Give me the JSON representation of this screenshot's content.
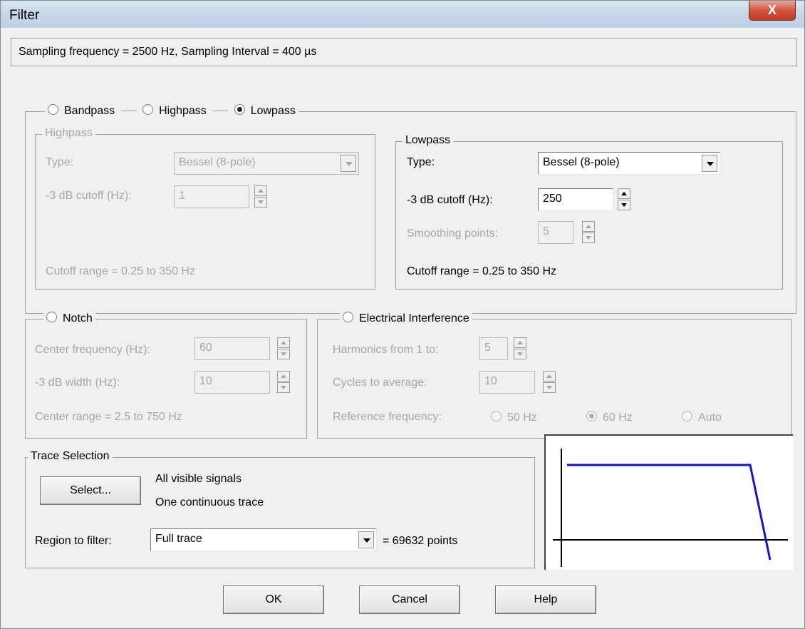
{
  "window": {
    "title": "Filter",
    "close_label": "X"
  },
  "info": {
    "text": "Sampling frequency = 2500 Hz, Sampling Interval = 400 µs"
  },
  "filter_type": {
    "bandpass": "Bandpass",
    "highpass": "Highpass",
    "lowpass": "Lowpass",
    "selected": "Lowpass"
  },
  "highpass": {
    "legend": "Highpass",
    "type_label": "Type:",
    "type_value": "Bessel (8-pole)",
    "cutoff_label": "-3 dB cutoff (Hz):",
    "cutoff_value": "1",
    "range_text": "Cutoff range = 0.25 to 350 Hz"
  },
  "lowpass": {
    "legend": "Lowpass",
    "type_label": "Type:",
    "type_value": "Bessel (8-pole)",
    "cutoff_label": "-3 dB cutoff (Hz):",
    "cutoff_value": "250",
    "smoothing_label": "Smoothing points:",
    "smoothing_value": "5",
    "range_text": "Cutoff range = 0.25 to 350 Hz"
  },
  "notch": {
    "legend": "Notch",
    "center_label": "Center frequency (Hz):",
    "center_value": "60",
    "width_label": "-3 dB width (Hz):",
    "width_value": "10",
    "range_text": "Center range = 2.5 to 750 Hz"
  },
  "interference": {
    "legend": "Electrical Interference",
    "harmonics_label": "Harmonics from 1 to:",
    "harmonics_value": "5",
    "cycles_label": "Cycles to average:",
    "cycles_value": "10",
    "ref_label": "Reference frequency:",
    "ref_50": "50 Hz",
    "ref_60": "60 Hz",
    "ref_auto": "Auto",
    "ref_selected": "60 Hz"
  },
  "trace": {
    "legend": "Trace Selection",
    "select_label": "Select...",
    "signals_text": "All visible signals",
    "trace_text": "One continuous trace",
    "region_label": "Region to filter:",
    "region_value": "Full trace",
    "points_text": "= 69632 points"
  },
  "buttons": {
    "ok": "OK",
    "cancel": "Cancel",
    "help": "Help"
  },
  "colors": {
    "response_line": "#1414c8",
    "axes": "#000000"
  }
}
